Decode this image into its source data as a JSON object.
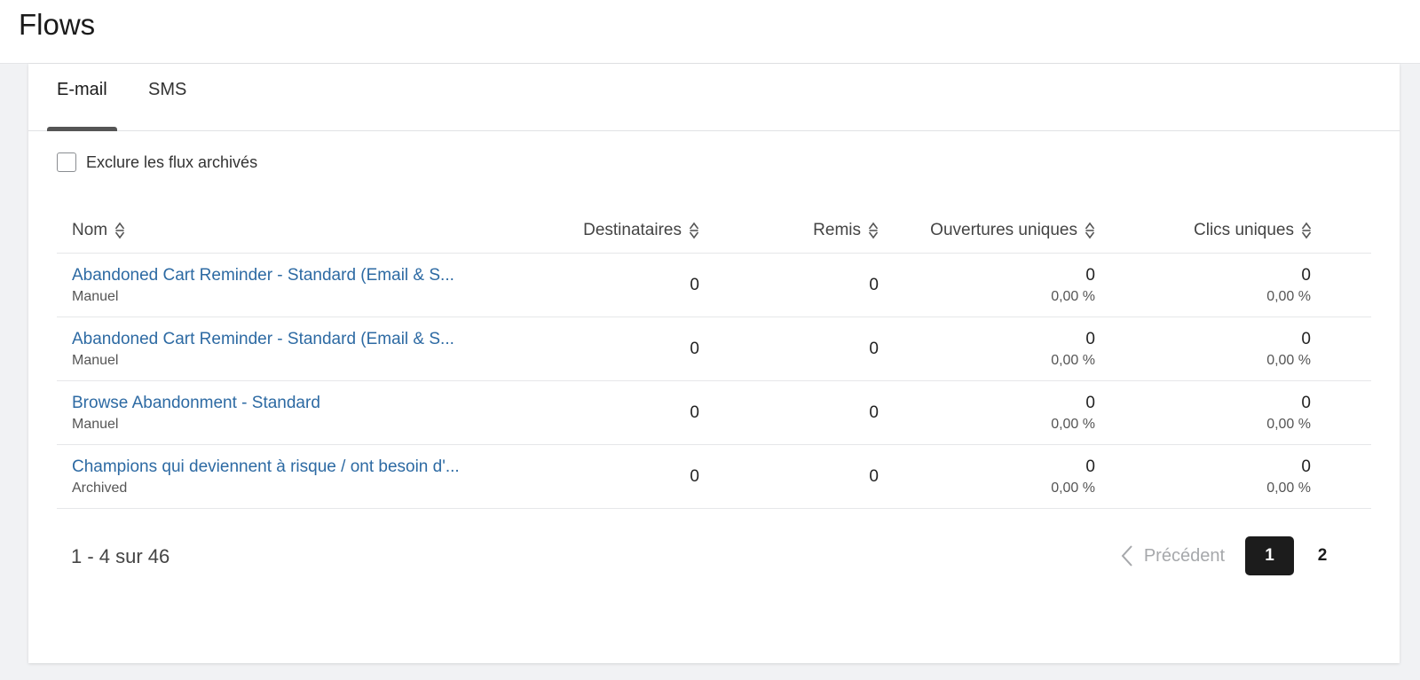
{
  "header": {
    "title": "Flows"
  },
  "tabs": [
    {
      "label": "E-mail",
      "active": true
    },
    {
      "label": "SMS",
      "active": false
    }
  ],
  "filter": {
    "label": "Exclure les flux archivés",
    "checked": false
  },
  "table": {
    "columns": {
      "name": "Nom",
      "recipients": "Destinataires",
      "delivered": "Remis",
      "unique_opens": "Ouvertures uniques",
      "unique_clicks": "Clics uniques"
    },
    "rows": [
      {
        "name": "Abandoned Cart Reminder - Standard (Email & S...",
        "type": "Manuel",
        "recipients": "0",
        "delivered": "0",
        "opens": "0",
        "opens_pct": "0,00 %",
        "clicks": "0",
        "clicks_pct": "0,00 %"
      },
      {
        "name": "Abandoned Cart Reminder - Standard (Email & S...",
        "type": "Manuel",
        "recipients": "0",
        "delivered": "0",
        "opens": "0",
        "opens_pct": "0,00 %",
        "clicks": "0",
        "clicks_pct": "0,00 %"
      },
      {
        "name": "Browse Abandonment - Standard",
        "type": "Manuel",
        "recipients": "0",
        "delivered": "0",
        "opens": "0",
        "opens_pct": "0,00 %",
        "clicks": "0",
        "clicks_pct": "0,00 %"
      },
      {
        "name": "Champions qui deviennent à risque / ont besoin d'...",
        "type": "Archived",
        "recipients": "0",
        "delivered": "0",
        "opens": "0",
        "opens_pct": "0,00 %",
        "clicks": "0",
        "clicks_pct": "0,00 %"
      }
    ]
  },
  "footer": {
    "count": "1 - 4 sur 46",
    "pagination": {
      "prev": "Précédent",
      "current_page": "1",
      "next_page": "2"
    }
  },
  "icons": {
    "sort": "sort-icon",
    "prev": "chevron-left-icon"
  },
  "colors": {
    "link": "#2d6aa3",
    "active_page_bg": "#1c1c1c",
    "tab_underline": "#555555"
  }
}
